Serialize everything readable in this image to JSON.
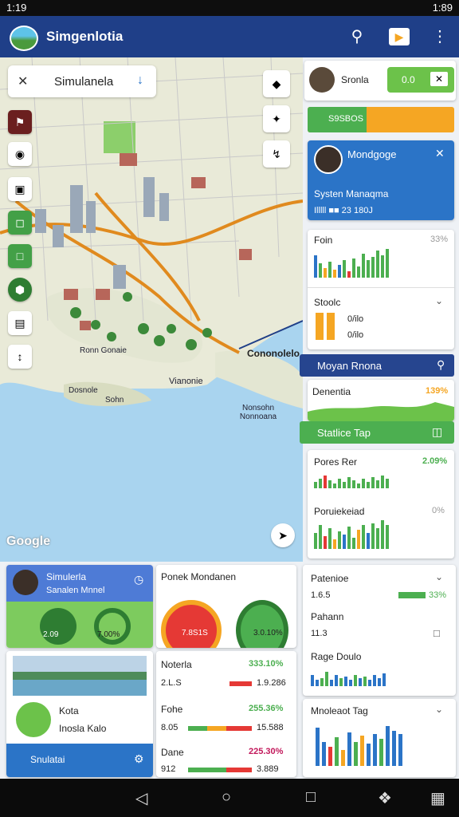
{
  "status": {
    "time": "1:19",
    "clock": "1:89"
  },
  "app": {
    "title": "Simgenlotia"
  },
  "search": {
    "value": "Simulanela"
  },
  "map": {
    "labels": [
      "Vianonie",
      "Ronn Gonaie",
      "Dosnole",
      "Sohn",
      "Nonsohn Nonnoana",
      "Cononolelo"
    ],
    "google": "Google"
  },
  "right": {
    "user": {
      "name": "Sronla",
      "btn": "0.0"
    },
    "progress": {
      "label": "S9SBOS"
    },
    "profile": {
      "name": "Mondgoge",
      "sub": "Systen Manaqma",
      "line": "Illlll  ■■ 23 180J"
    },
    "chart1": {
      "title": "Foin",
      "pct": "33%"
    },
    "chart2": {
      "title": "Stoolc",
      "v1": "0/ilo",
      "v2": "0/ilo"
    },
    "banner1": {
      "title": "Moyan Rnona"
    },
    "chart3": {
      "title": "Denentia",
      "pct": "139%"
    },
    "banner2": {
      "title": "Statlice Tap"
    },
    "chart4": {
      "title": "Pores Rer",
      "pct": "2.09%"
    },
    "chart5": {
      "title": "Poruiekeiad",
      "pct": "0%"
    }
  },
  "bottom_left": {
    "sim": {
      "name": "Simulerla",
      "sub": "Sanalen Mnnel",
      "g1": "2.09",
      "g2": "7.00%"
    },
    "gauge": {
      "title": "Ponek Mondanen",
      "g1": "7.8S1S",
      "g2": "3.0.10%"
    },
    "photo": {
      "name": "Kota",
      "sub": "Inosla Kalo",
      "btn": "Snulatai"
    },
    "rows": [
      {
        "name": "Noterla",
        "left": "2.L.S",
        "pct": "333.10%",
        "right": "1.9.286"
      },
      {
        "name": "Fohe",
        "left": "8.05",
        "pct": "255.36%",
        "right": "15.588"
      },
      {
        "name": "Dane",
        "left": "912",
        "pct": "225.30%",
        "right": "3.889"
      }
    ]
  },
  "bottom_right": {
    "p1": {
      "title": "Patenioe",
      "val": "1.6.5",
      "pct": "33%"
    },
    "p2": {
      "title": "Pahann",
      "val": "11.3"
    },
    "p3": {
      "title": "Rage Doulo"
    },
    "p4": {
      "title": "Mnoleaot Tag"
    }
  },
  "colors": {
    "primary": "#1f3f88",
    "green": "#4caf50",
    "orange": "#f5a623",
    "red": "#e53935",
    "blue": "#2b74c7"
  }
}
